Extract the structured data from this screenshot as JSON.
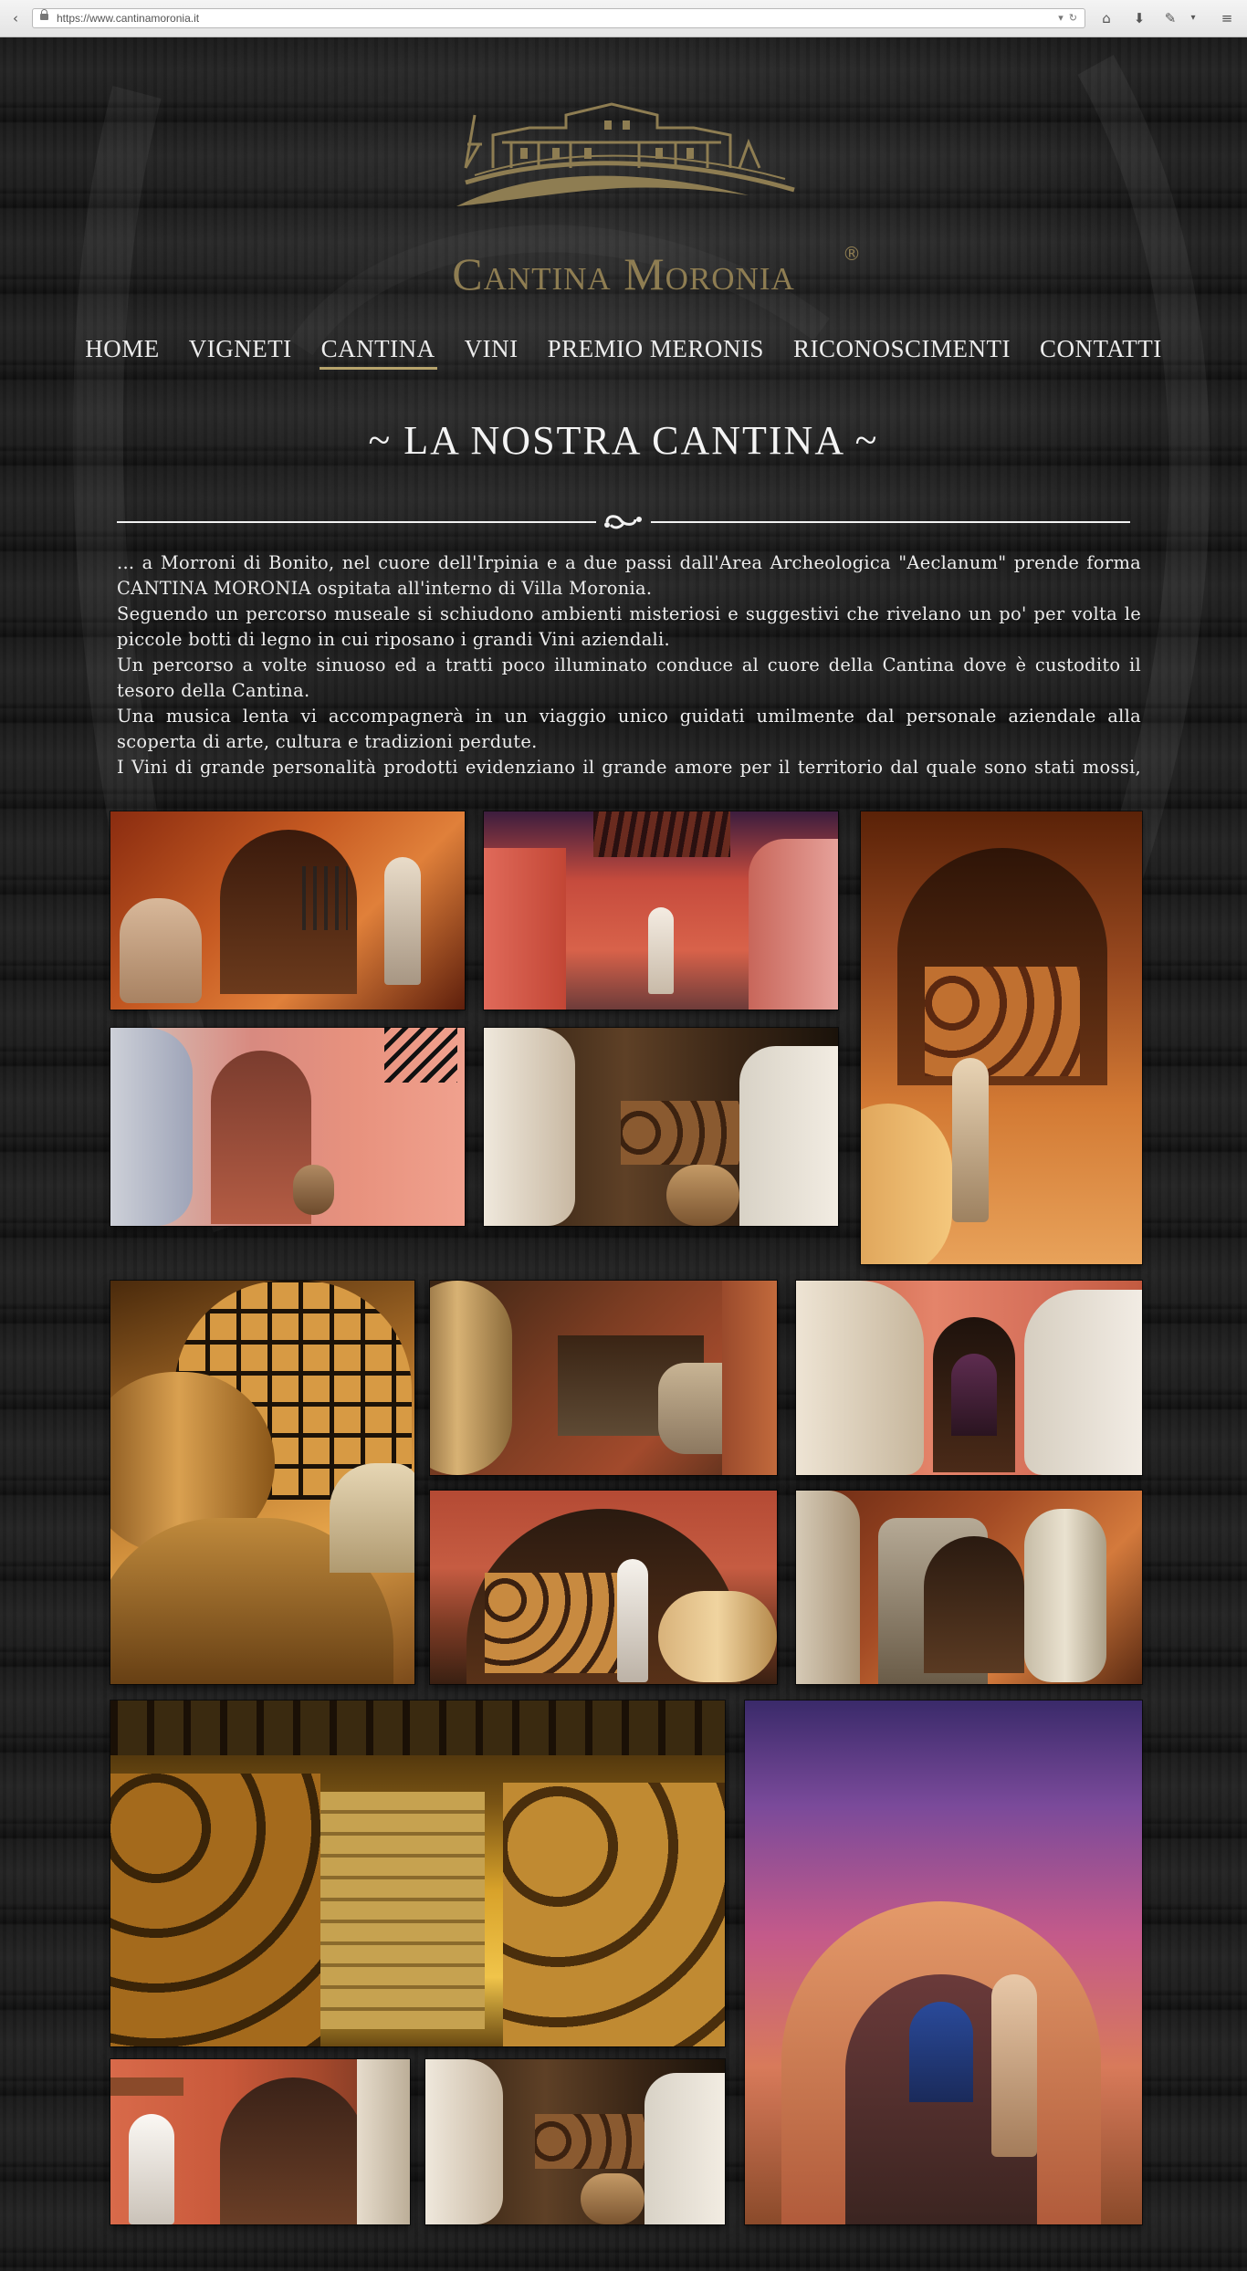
{
  "browser": {
    "url": "https://www.cantinamoronia.it"
  },
  "logo": {
    "name": "Cantina Moronia",
    "registered": "®"
  },
  "nav": {
    "items": [
      {
        "label": "HOME",
        "active": false
      },
      {
        "label": "VIGNETI",
        "active": false
      },
      {
        "label": "CANTINA",
        "active": true
      },
      {
        "label": "VINI",
        "active": false
      },
      {
        "label": "PREMIO MERONIS",
        "active": false
      },
      {
        "label": "RICONOSCIMENTI",
        "active": false
      },
      {
        "label": "CONTATTI",
        "active": false
      }
    ]
  },
  "heading": "~ LA NOSTRA CANTINA ~",
  "paragraphs": [
    "... a Morroni di Bonito, nel cuore dell'Irpinia e a due passi dall'Area Archeologica \"Aeclanum\" prende forma CANTINA MORONIA ospitata all'interno di Villa Moronia.",
    "Seguendo un percorso museale si schiudono ambienti misteriosi e suggestivi che rivelano un po' per volta le piccole botti di legno in cui riposano i grandi Vini aziendali.",
    "Un percorso a volte sinuoso ed a tratti poco illuminato conduce al cuore della Cantina dove è custodito il tesoro della Cantina.",
    "Una musica lenta vi accompagnerà in un viaggio unico guidati umilmente dal personale aziendale alla scoperta di arte, cultura e tradizioni perdute.",
    "I Vini di grande personalità prodotti evidenziano il grande amore per il territorio dal quale sono stati mossi, sin"
  ],
  "colors": {
    "gold": "#8e7d52",
    "nav_underline": "#b7a46c",
    "text": "#ededed"
  }
}
